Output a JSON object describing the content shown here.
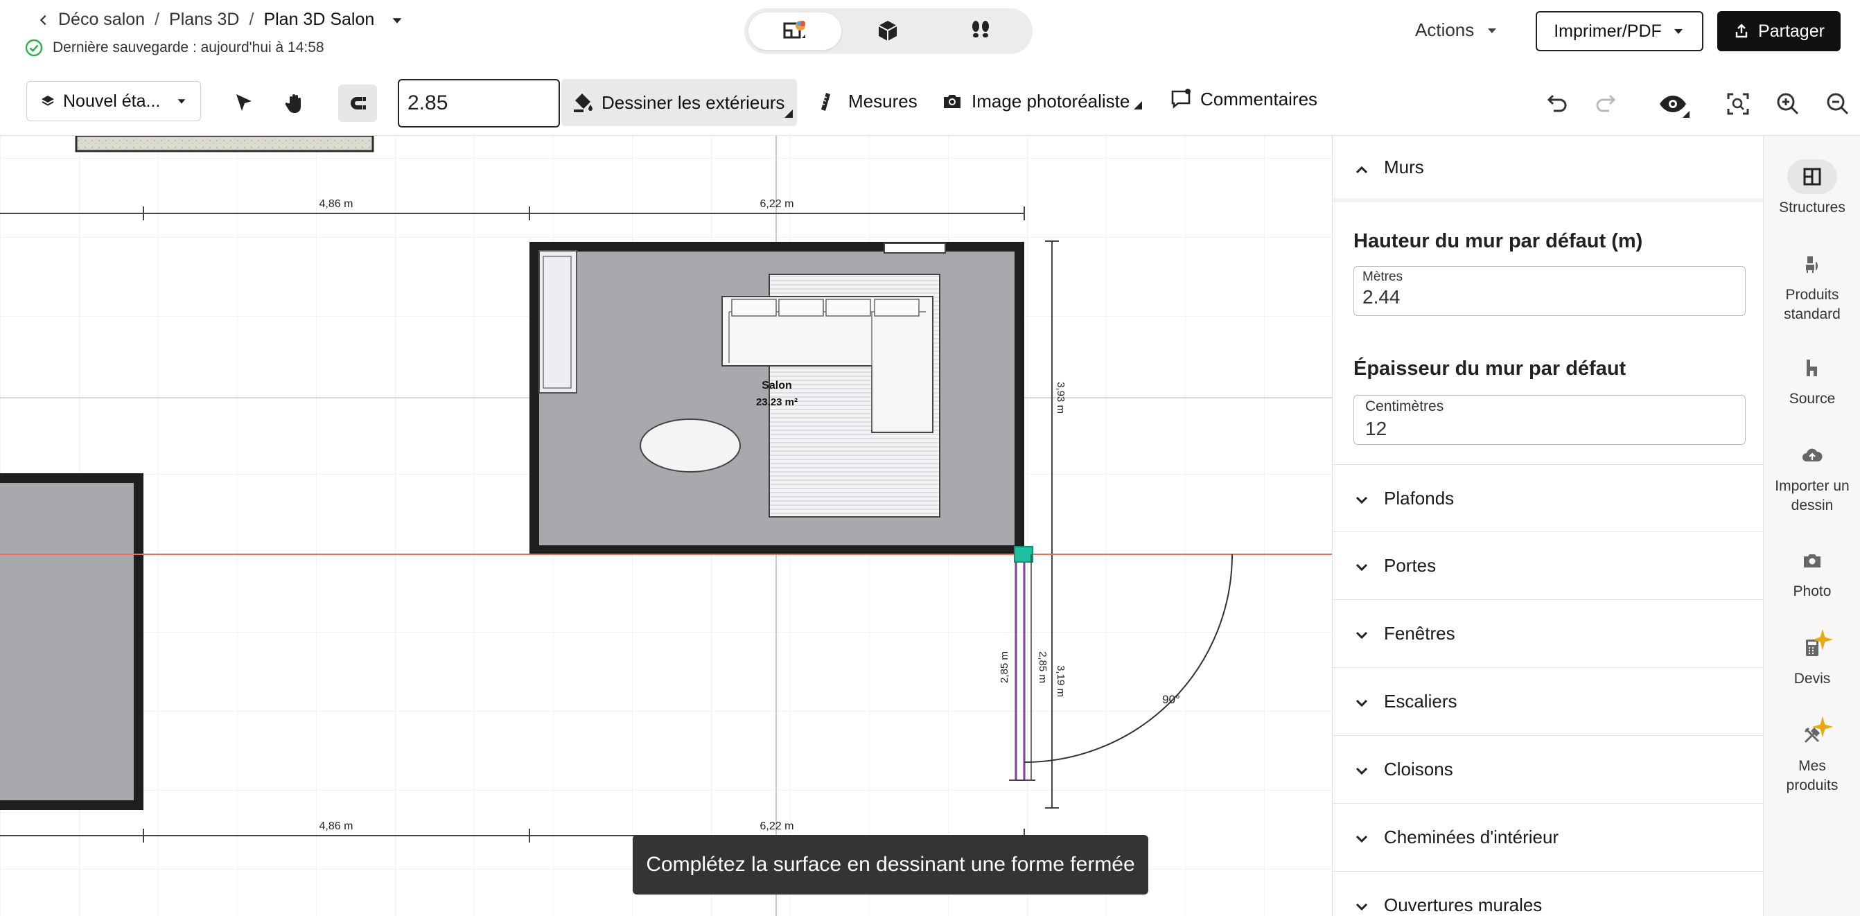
{
  "header": {
    "breadcrumbs": [
      "Déco salon",
      "Plans 3D",
      "Plan 3D Salon"
    ],
    "breadcrumb_sep": "/",
    "saved_status": "Dernière sauvegarde : aujourd'hui à 14:58",
    "view_modes": [
      "2D plan",
      "3D view",
      "walkthrough"
    ],
    "actions_label": "Actions",
    "print_label": "Imprimer/PDF",
    "share_label": "Partager"
  },
  "toolbar": {
    "level_label": "Nouvel éta...",
    "length_value": "2.85",
    "draw_exterior_label": "Dessiner les extérieurs",
    "measures_label": "Mesures",
    "photoreal_label": "Image photoréaliste",
    "comments_label": "Commentaires"
  },
  "canvas": {
    "room_name": "Salon",
    "room_area": "23.23 m²",
    "dim_top_left": "4,86 m",
    "dim_top_right": "6,22 m",
    "dim_bottom_left": "4,86 m",
    "dim_bottom_right": "6,22 m",
    "dim_right_room": "3,93 m",
    "dim_wall_left": "2,85 m",
    "dim_wall_right": "2,85 m",
    "dim_total_right": "3,19 m",
    "angle": "90°",
    "toast": "Complétez la surface en dessinant une forme fermée",
    "colors": {
      "floor": "#a8a9ad",
      "wall": "#1e1e1e",
      "guide": "#e8705a",
      "drawn_wall": "#7b3fa0",
      "node": "#1fbf9f"
    }
  },
  "panel": {
    "walls_title": "Murs",
    "height_title": "Hauteur du mur par défaut (m)",
    "height_unit": "Mètres",
    "height_value": "2.44",
    "thickness_title": "Épaisseur du mur par défaut",
    "thickness_unit": "Centimètres",
    "thickness_value": "12",
    "sections": [
      "Plafonds",
      "Portes",
      "Fenêtres",
      "Escaliers",
      "Cloisons",
      "Cheminées d'intérieur",
      "Ouvertures murales"
    ]
  },
  "rail": {
    "items": [
      {
        "label": "Structures",
        "icon": "structures-icon"
      },
      {
        "label": "Produits standard",
        "icon": "products-icon"
      },
      {
        "label": "Source",
        "icon": "source-icon"
      },
      {
        "label": "Importer un dessin",
        "icon": "cloud-upload-icon"
      },
      {
        "label": "Photo",
        "icon": "camera-icon"
      },
      {
        "label": "Devis",
        "icon": "calculator-icon"
      },
      {
        "label": "Mes produits",
        "icon": "tools-icon"
      }
    ]
  }
}
